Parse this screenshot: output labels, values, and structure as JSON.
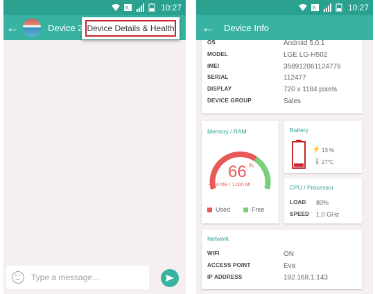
{
  "statusbar": {
    "time": "10:27"
  },
  "left": {
    "chat_title": "Device 2",
    "menu_item": "Device Details & Health",
    "composer_placeholder": "Type a message..."
  },
  "right": {
    "title": "Device Info",
    "device": [
      {
        "key": "OS",
        "value": "Android 5.0.1"
      },
      {
        "key": "MODEL",
        "value": "LGE LG-H502"
      },
      {
        "key": "IMEI",
        "value": "358912061124776"
      },
      {
        "key": "SERIAL",
        "value": "112477"
      },
      {
        "key": "DISPLAY",
        "value": "720 x 1184 pixels"
      },
      {
        "key": "DEVICE GROUP",
        "value": "Sales"
      }
    ],
    "memory": {
      "title": "Memory / RAM",
      "percent": "66",
      "percent_sign": "%",
      "used_fraction": 0.66,
      "detail": "-66.8 MB / 1,000 MI",
      "used_label": "Used",
      "free_label": "Free"
    },
    "battery": {
      "title": "Battery",
      "level": "13 %",
      "temp": "27℃",
      "level_fraction": 0.13
    },
    "cpu": {
      "title": "CPU / Processor",
      "load_key": "LOAD",
      "load_value": "80%",
      "speed_key": "SPEED",
      "speed_value": "1.0 GHz"
    },
    "network": {
      "title": "Network",
      "rows": [
        {
          "key": "WIFI",
          "value": "ON"
        },
        {
          "key": "ACCESS POINT",
          "value": "Eva"
        },
        {
          "key": "IP ADDRESS",
          "value": "192.168.1.143"
        }
      ]
    }
  },
  "colors": {
    "primary": "#38b3a1",
    "dark": "#2aa08f",
    "used": "#e85a5a",
    "free": "#7ccf7a",
    "alert": "#c8272d"
  }
}
